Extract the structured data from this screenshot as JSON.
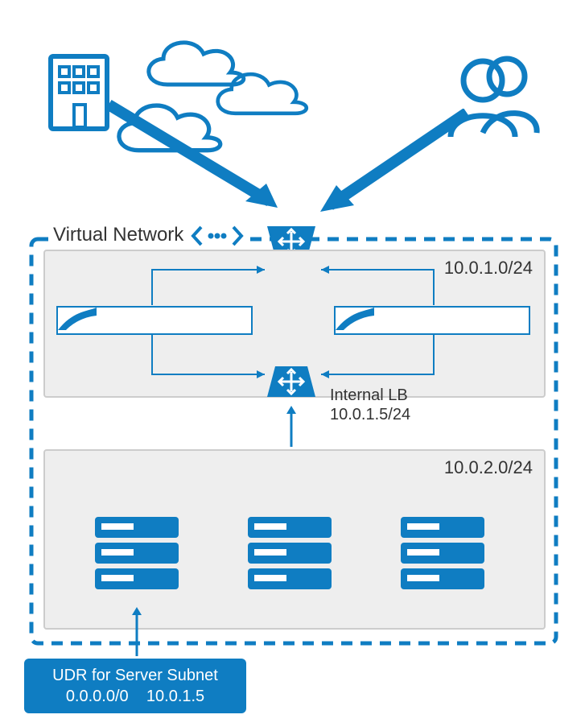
{
  "diagram": {
    "vnet_label": "Virtual Network",
    "subnet_firewall_cidr": "10.0.1.0/24",
    "subnet_server_cidr": "10.0.2.0/24",
    "internal_lb_label": "Internal LB",
    "internal_lb_ip": "10.0.1.5/24",
    "udr_title": "UDR for Server Subnet",
    "udr_route_prefix": "0.0.0.0/0",
    "udr_next_hop": "10.0.1.5"
  },
  "colors": {
    "primary": "#0f7dc2"
  }
}
